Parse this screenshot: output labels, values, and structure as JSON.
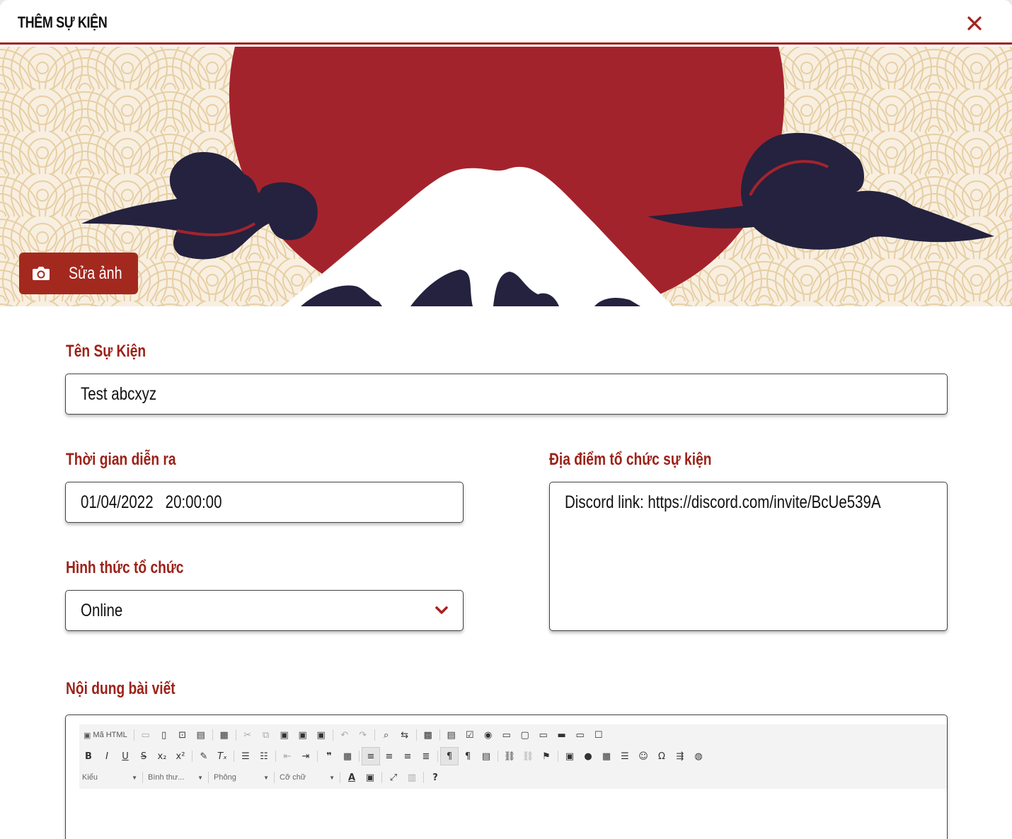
{
  "header": {
    "title": "THÊM SỰ KIỆN"
  },
  "banner": {
    "edit_photo_label": "Sửa ảnh"
  },
  "form": {
    "event_name_label": "Tên Sự Kiện",
    "event_name_value": "Test abcxyz",
    "time_label": "Thời gian diễn ra",
    "time_value": "01/04/2022   20:00:00",
    "location_label": "Địa điểm tổ chức sự kiện",
    "location_value": "Discord link: https://discord.com/invite/BcUe539A",
    "format_label": "Hình thức tổ chức",
    "format_value": "Online",
    "content_label": "Nội dung bài viết"
  },
  "editor": {
    "source_label": "Mã HTML",
    "style_combo": "Kiểu",
    "format_combo": "Bình thư...",
    "font_combo": "Phông",
    "size_combo": "Cỡ chữ",
    "help": "?"
  },
  "colors": {
    "accent": "#a3221f",
    "sun": "#a3232d",
    "cloud": "#24223e",
    "pattern_bg": "#f8efe1",
    "pattern_line": "#e7cfa3"
  }
}
